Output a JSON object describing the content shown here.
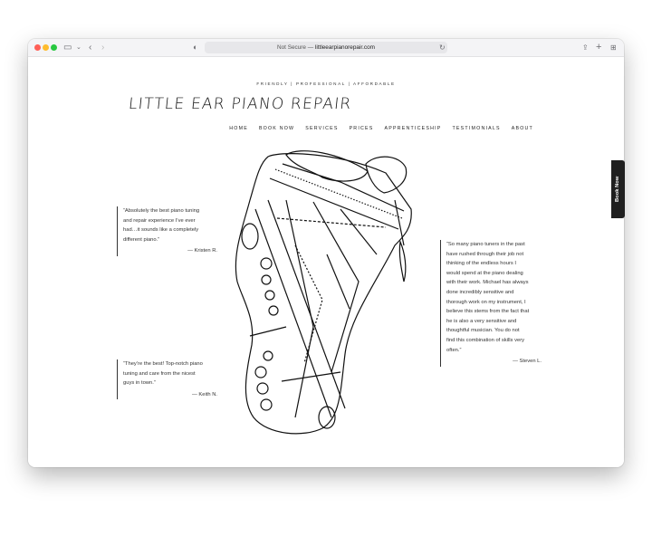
{
  "browser": {
    "address_prefix": "Not Secure — ",
    "address_domain": "littleearpianorepair.com"
  },
  "site": {
    "tagline": "FRIENDLY | PROFESSIONAL | AFFORDABLE",
    "logo_text": "LITTLE EAR PIANO REPAIR"
  },
  "nav": [
    "HOME",
    "BOOK NOW",
    "SERVICES",
    "PRICES",
    "APPRENTICESHIP",
    "TESTIMONIALS",
    "ABOUT"
  ],
  "testimonials": [
    {
      "lines": [
        "“Absolutely the best piano tuning",
        "and repair experience I’ve ever",
        "had…it sounds like a completely",
        "different piano.”"
      ],
      "author": "— Kristen R."
    },
    {
      "lines": [
        "“So many piano tuners in the past",
        "have rushed through their job not",
        "thinking of the endless hours I",
        "would spend at the piano dealing",
        "with their work. Michael has always",
        "done incredibly sensitive and",
        "thorough work on my instrument, I",
        "believe this stems from the fact that",
        "he is also a very sensitive and",
        "thoughtful musician. You do not",
        "find this combination of skills very",
        "often.”"
      ],
      "author": "— Steven L."
    },
    {
      "lines": [
        "“They’re the best! Top-notch piano",
        "tuning and care from the nicest",
        "guys in town.”"
      ],
      "author": "— Keith N."
    }
  ],
  "book_tab": "Book Now"
}
